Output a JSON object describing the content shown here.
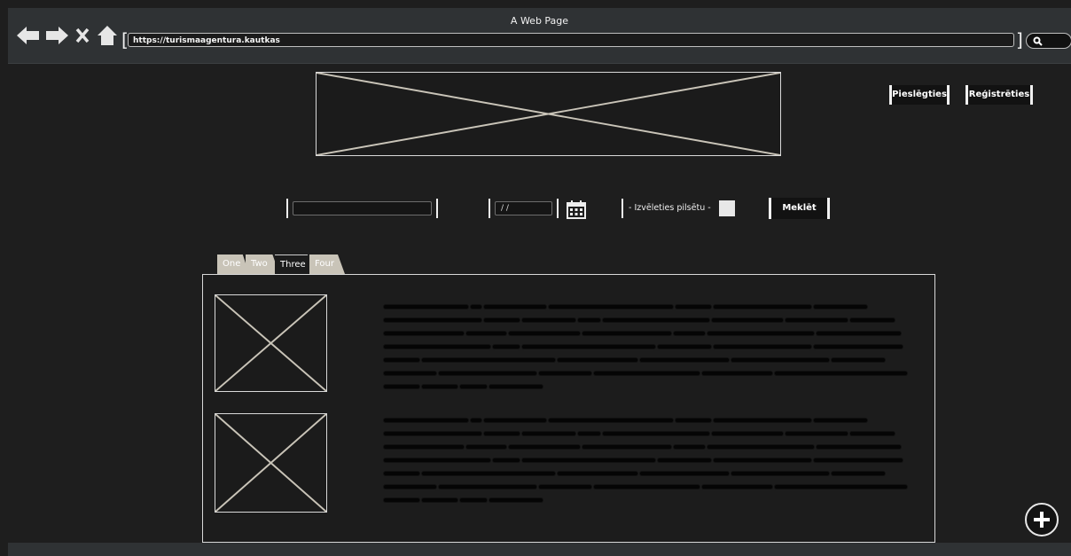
{
  "window": {
    "title": "A Web Page"
  },
  "browser": {
    "url": "https://turismaagentura.kautkas",
    "icons": [
      "back-arrow-icon",
      "forward-arrow-icon",
      "close-icon",
      "home-icon",
      "search-icon"
    ]
  },
  "header": {
    "login_label": "Pieslēgties",
    "register_label": "Reģistrēties"
  },
  "search_form": {
    "text_value": "",
    "date_value": "/ /",
    "city_select_value": "- Izvēleties pilsētu -",
    "search_button_label": "Meklēt"
  },
  "tabs": [
    {
      "label": "One"
    },
    {
      "label": "Two"
    },
    {
      "label": "Three",
      "active": true
    },
    {
      "label": "Four"
    }
  ],
  "colors": {
    "background": "#1e1e1e",
    "chrome": "#2f3234",
    "accent_tab": "#c9c4b8"
  }
}
